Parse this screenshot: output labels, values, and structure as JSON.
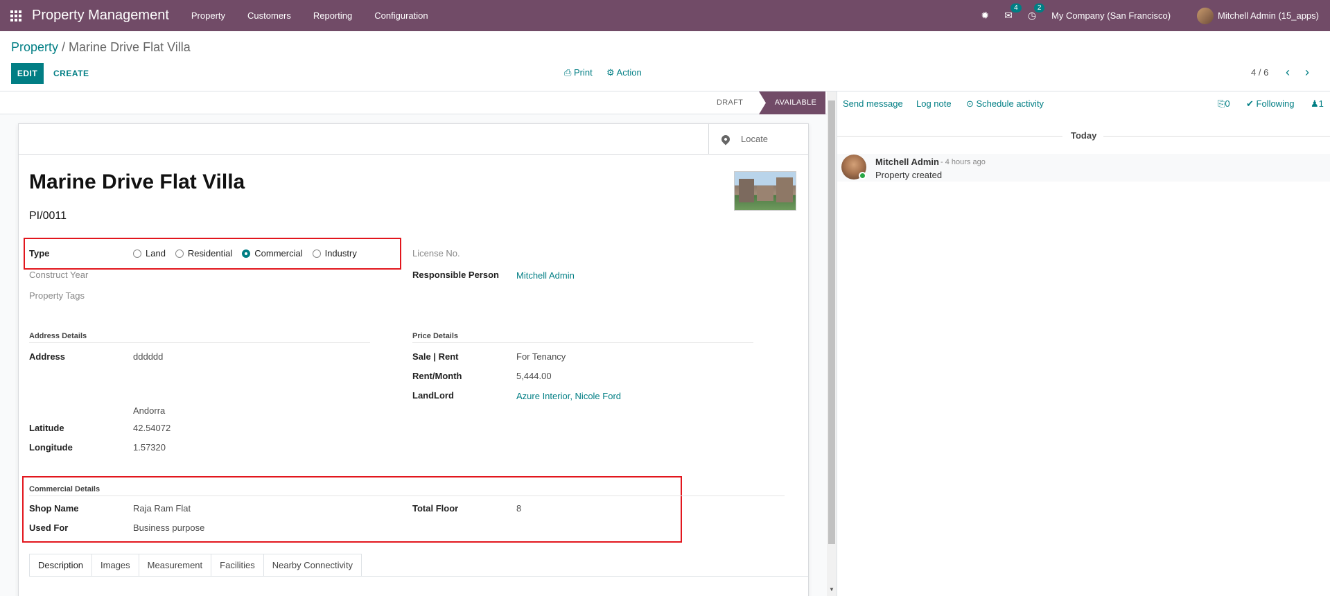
{
  "navbar": {
    "app_name": "Property Management",
    "menu": [
      "Property",
      "Customers",
      "Reporting",
      "Configuration"
    ],
    "messages_count": "4",
    "activities_count": "2",
    "company": "My Company (San Francisco)",
    "user": "Mitchell Admin (15_apps)"
  },
  "control_panel": {
    "breadcrumb_parent": "Property",
    "breadcrumb_separator": " / ",
    "breadcrumb_current": "Marine Drive Flat Villa",
    "edit_label": "EDIT",
    "create_label": "CREATE",
    "print_label": "⎙ Print",
    "action_label": "⚙ Action",
    "pager": "4 / 6"
  },
  "statusbar": {
    "stages": [
      "DRAFT",
      "AVAILABLE"
    ],
    "active_stage": "AVAILABLE"
  },
  "form": {
    "locate_label": "Locate",
    "title": "Marine Drive Flat Villa",
    "reference": "PI/0011",
    "type_label": "Type",
    "type_options": [
      "Land",
      "Residential",
      "Commercial",
      "Industry"
    ],
    "type_selected": "Commercial",
    "construct_year_label": "Construct Year",
    "property_tags_label": "Property Tags",
    "license_no_label": "License No.",
    "responsible_person_label": "Responsible Person",
    "responsible_person": "Mitchell Admin",
    "address_section": "Address Details",
    "address_label": "Address",
    "address_street": "dddddd",
    "address_country": "Andorra",
    "latitude_label": "Latitude",
    "latitude": "42.54072",
    "longitude_label": "Longitude",
    "longitude": "1.57320",
    "price_section": "Price Details",
    "sale_rent_label": "Sale | Rent",
    "sale_rent": "For Tenancy",
    "rent_month_label": "Rent/Month",
    "rent_month": "5,444.00",
    "landlord_label": "LandLord",
    "landlord": "Azure Interior, Nicole Ford",
    "commercial_section": "Commercial Details",
    "shop_name_label": "Shop Name",
    "shop_name": "Raja Ram Flat",
    "used_for_label": "Used For",
    "used_for": "Business purpose",
    "total_floor_label": "Total Floor",
    "total_floor": "8",
    "tabs": [
      "Description",
      "Images",
      "Measurement",
      "Facilities",
      "Nearby Connectivity"
    ]
  },
  "chatter": {
    "send_message": "Send message",
    "log_note": "Log note",
    "schedule_activity": "⊙ Schedule activity",
    "attachments": "0",
    "following": "✔ Following",
    "followers": "1",
    "today_label": "Today",
    "messages": [
      {
        "author": "Mitchell Admin",
        "time": "- 4 hours ago",
        "body": "Property created"
      }
    ]
  },
  "colors": {
    "brand": "#714b67",
    "accent": "#017e84",
    "highlight_box": "#e2161d"
  }
}
